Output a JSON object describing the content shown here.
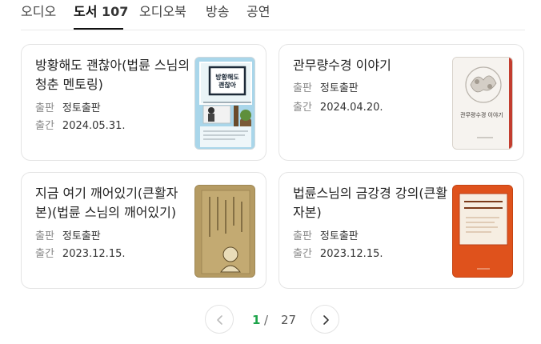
{
  "tabs": [
    {
      "label": "오디오"
    },
    {
      "label": "도서",
      "count": "107"
    },
    {
      "label": "오디오북"
    },
    {
      "label": "방송"
    },
    {
      "label": "공연"
    }
  ],
  "books": [
    {
      "title": "방황해도 괜찮아(법륜 스님의 청춘 멘토링)",
      "publisher_label": "출판",
      "publisher": "정토출판",
      "date_label": "출간",
      "date": "2024.05.31.",
      "cover_title": "방황해도 괜찮아"
    },
    {
      "title": "관무량수경 이야기",
      "publisher_label": "출판",
      "publisher": "정토출판",
      "date_label": "출간",
      "date": "2024.04.20.",
      "cover_title": "관무량수경 이야기"
    },
    {
      "title": "지금 여기 깨어있기(큰활자본)(법륜 스님의 깨어있기)",
      "publisher_label": "출판",
      "publisher": "정토출판",
      "date_label": "출간",
      "date": "2023.12.15."
    },
    {
      "title": "법륜스님의 금강경 강의(큰활자본)",
      "publisher_label": "출판",
      "publisher": "정토출판",
      "date_label": "출간",
      "date": "2023.12.15."
    }
  ],
  "pagination": {
    "current": "1",
    "separator": "/",
    "total": "27"
  },
  "colors": {
    "page_current": "#1ea44b",
    "cover_orange": "#e0531c",
    "cover_khaki": "#b49a62"
  },
  "icons": {
    "prev": "chevron-left-icon",
    "next": "chevron-right-icon"
  }
}
